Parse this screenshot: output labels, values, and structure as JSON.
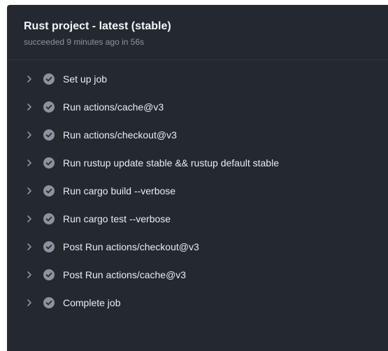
{
  "job": {
    "title": "Rust project - latest (stable)",
    "status_line": "succeeded 9 minutes ago in 56s"
  },
  "steps": [
    {
      "label": "Set up job",
      "status": "success"
    },
    {
      "label": "Run actions/cache@v3",
      "status": "success"
    },
    {
      "label": "Run actions/checkout@v3",
      "status": "success"
    },
    {
      "label": "Run rustup update stable && rustup default stable",
      "status": "success"
    },
    {
      "label": "Run cargo build --verbose",
      "status": "success"
    },
    {
      "label": "Run cargo test --verbose",
      "status": "success"
    },
    {
      "label": "Post Run actions/checkout@v3",
      "status": "success"
    },
    {
      "label": "Post Run actions/cache@v3",
      "status": "success"
    },
    {
      "label": "Complete job",
      "status": "success"
    }
  ],
  "icons": {
    "expand": "chevron-right-icon",
    "status": "check-circle-icon"
  },
  "colors": {
    "panel_background": "#24292f",
    "check_fill": "#8b949e",
    "title_text": "#f0f6fc",
    "muted_text": "#8b949e"
  }
}
